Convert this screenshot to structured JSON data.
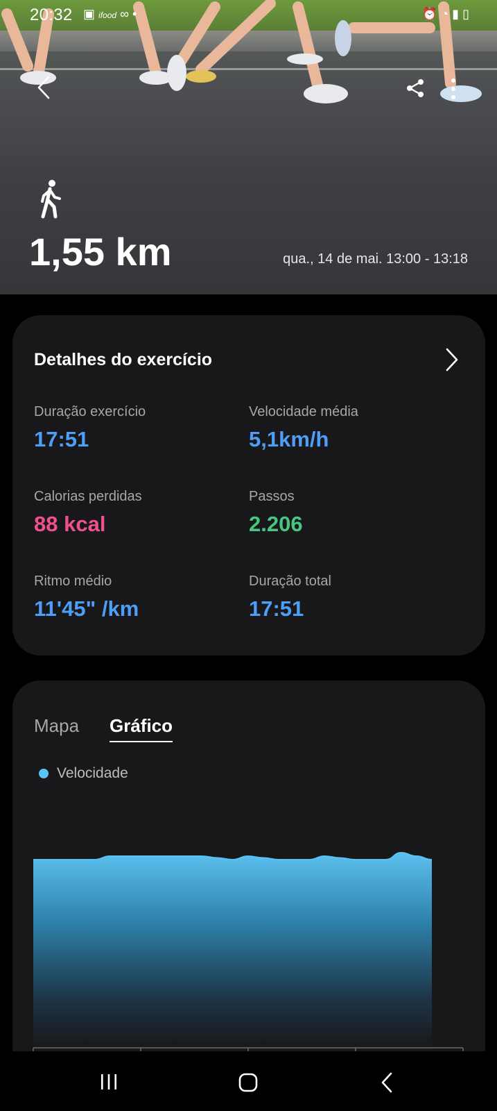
{
  "status_bar": {
    "time": "20:32",
    "left_icons": [
      "image-icon",
      "ifood-icon",
      "voicemail-icon",
      "dot-icon"
    ],
    "right_icons": [
      "alarm-icon",
      "wifi-icon",
      "signal-icon",
      "battery-icon"
    ]
  },
  "hero": {
    "distance": "1,55 km",
    "datetime": "qua., 14 de mai. 13:00 - 13:18",
    "activity_icon": "walking-icon"
  },
  "details": {
    "title": "Detalhes do exercício",
    "metrics": [
      {
        "label": "Duração exercício",
        "value": "17:51",
        "color": "#4d9ef7"
      },
      {
        "label": "Velocidade média",
        "value": "5,1km/h",
        "color": "#4d9ef7"
      },
      {
        "label": "Calorias perdidas",
        "value": "88 kcal",
        "color": "#f0508e"
      },
      {
        "label": "Passos",
        "value": "2.206",
        "color": "#47c77e"
      },
      {
        "label": "Ritmo médio",
        "value": "11'45\" /km",
        "color": "#4d9ef7"
      },
      {
        "label": "Duração total",
        "value": "17:51",
        "color": "#4d9ef7"
      }
    ]
  },
  "tabs": {
    "map": "Mapa",
    "graph": "Gráfico"
  },
  "legend": {
    "speed": "Velocidade",
    "color": "#58c4f5"
  },
  "chart_data": {
    "type": "area",
    "series": [
      {
        "name": "Velocidade",
        "values": [
          5.0,
          5.0,
          5.0,
          5.0,
          5.0,
          5.1,
          5.1,
          5.1,
          5.1,
          5.1,
          5.1,
          5.1,
          5.05,
          5.0,
          5.1,
          5.05,
          5.0,
          5.0,
          5.0,
          5.1,
          5.05,
          5.0,
          5.0,
          5.0,
          5.2,
          5.1,
          5.0
        ]
      }
    ]
  },
  "nav": {
    "icons": [
      "recent-apps-icon",
      "home-icon",
      "back-icon"
    ]
  }
}
